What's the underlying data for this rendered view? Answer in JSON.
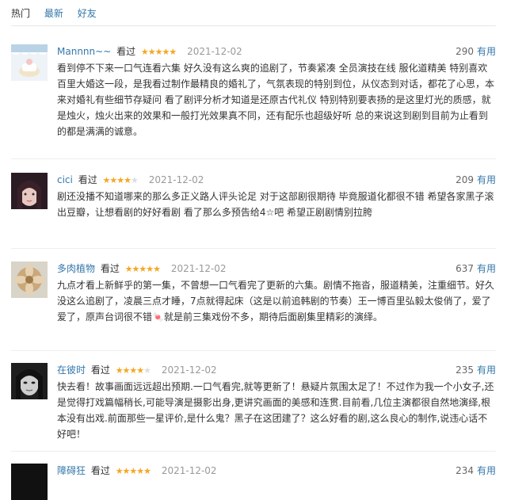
{
  "tabs": [
    {
      "label": "热门"
    },
    {
      "label": "最新"
    },
    {
      "label": "好友"
    }
  ],
  "watched_label": "看过",
  "useful_label": "有用",
  "reviews": [
    {
      "user": "Mannnn~~",
      "rating": 5,
      "stars": "★★★★★",
      "date": "2021-12-02",
      "votes": "290",
      "content": "看到停不下来一口气连看六集 好久没有这么爽的追剧了，节奏紧凑 全员演技在线 服化道精美 特别喜欢百里大婚这一段，是我看过制作最精良的婚礼了，气氛表现的特别到位，从仪态到对话，都花了心思，本来对婚礼有些细节存疑问 看了剧评分析才知道是还原古代礼仪 特别特别要表扬的是这里灯光的质感，就是烛火，烛火出来的效果和一般打光效果真不同，还有配乐也超级好听 总的来说这到剧到目前为止看到的都是满满的诚意。"
    },
    {
      "user": "cici",
      "rating": 4,
      "stars": "★★★★",
      "stars_off": "★",
      "date": "2021-12-02",
      "votes": "209",
      "content": "剧还没播不知道哪来的那么多正义路人评头论足 对于这部剧很期待 毕竟服道化都很不错 希望各家黑子滚出豆瓣，让想看剧的好好看剧 看了那么多预告给4☆吧 希望正剧剧情别拉胯"
    },
    {
      "user": "多肉植物",
      "rating": 5,
      "stars": "★★★★★",
      "date": "2021-12-02",
      "votes": "637",
      "content": "九点才看上新鲜乎的第一集，不曾想一口气看完了更新的六集。剧情不拖沓，服道精美，注重细节。好久没这么追剧了，凌晨三点才睡，7点就得起床（这是以前追韩剧的节奏）王一博百里弘毅太俊俏了，爱了爱了，原声台词很不错🍬就是前三集戏份不多，期待后面剧集里精彩的演绎。"
    },
    {
      "user": "在彼时",
      "rating": 4,
      "stars": "★★★★",
      "stars_off": "★",
      "date": "2021-12-02",
      "votes": "235",
      "content": "快去看！故事画面远远超出预期.一口气看完,就等更新了！悬疑片氛围太足了！不过作为我一个小女子,还是觉得打戏篇幅稍长,可能导演是摄影出身,更讲究画面的美感和连贯.目前看,几位主演都很自然地演绎,根本没有出戏.前面那些一星评价,是什么鬼？黑子在这团建了？这么好看的剧,这么良心的制作,说违心话不好吧！"
    },
    {
      "user": "障碍狂",
      "rating": 5,
      "stars": "★★★★★",
      "date": "2021-12-02",
      "votes": "234",
      "content": ""
    }
  ]
}
